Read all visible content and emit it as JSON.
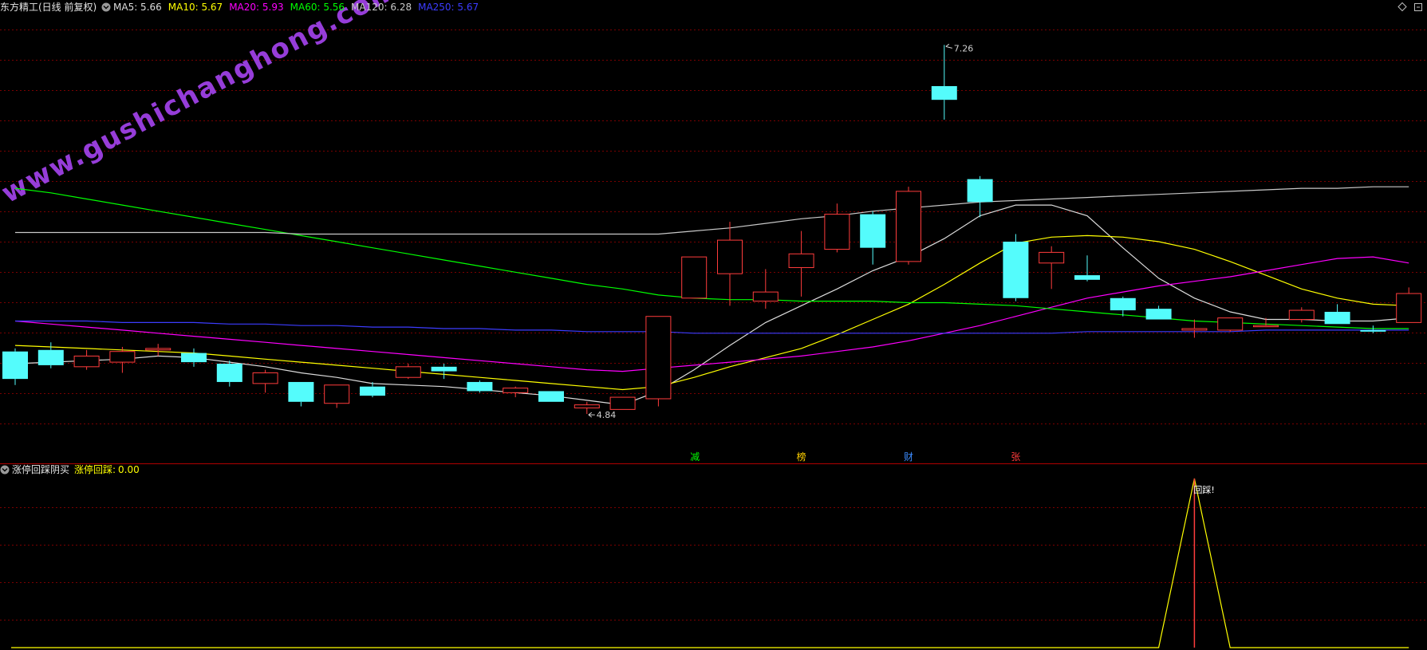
{
  "colors": {
    "bg": "#000000",
    "grid": "#7a0000",
    "up": "#ff3c3c",
    "down": "#54fcfc",
    "ma5": "#dcdcdc",
    "ma10": "#ffff00",
    "ma20": "#ff00ff",
    "ma60": "#00ff00",
    "ma120": "#c8c8c8",
    "ma250": "#3c3cff",
    "indicator": "#ffff00",
    "marker": "#ff3c3c",
    "watermark": "#b048ff"
  },
  "header": {
    "title": "东方精工(日线 前复权)",
    "ma": [
      {
        "label": "MA5:",
        "value": "5.66",
        "color": "#dcdcdc"
      },
      {
        "label": "MA10:",
        "value": "5.67",
        "color": "#ffff00"
      },
      {
        "label": "MA20:",
        "value": "5.93",
        "color": "#ff00ff"
      },
      {
        "label": "MA60:",
        "value": "5.56",
        "color": "#00ff00"
      },
      {
        "label": "MA120:",
        "value": "6.28",
        "color": "#c8c8c8"
      },
      {
        "label": "MA250:",
        "value": "5.67",
        "color": "#3c3cff"
      }
    ],
    "icons": [
      "collapse-icon",
      "diamond-icon",
      "restore-icon"
    ]
  },
  "watermark": "www.gushichanghong.com",
  "price_panel": {
    "high_label": "7.26",
    "low_label": "4.84",
    "event_markers": [
      {
        "text": "减",
        "color": "#00ff00"
      },
      {
        "text": "榜",
        "color": "#ffd000"
      },
      {
        "text": "财",
        "color": "#3c8cff"
      },
      {
        "text": "张",
        "color": "#ff3c3c"
      }
    ]
  },
  "indicator_panel": {
    "title": "涨停回踩阴买",
    "series_label": "涨停回踩:",
    "series_value": "0.00",
    "signal_label": "回踩!"
  },
  "chart_data": {
    "type": "candlestick",
    "title": "东方精工(日线 前复权)",
    "ylim": [
      4.6,
      7.45
    ],
    "candles": [
      {
        "o": 5.25,
        "c": 5.07,
        "h": 5.27,
        "l": 5.03
      },
      {
        "o": 5.26,
        "c": 5.16,
        "h": 5.31,
        "l": 5.14
      },
      {
        "o": 5.15,
        "c": 5.22,
        "h": 5.26,
        "l": 5.13
      },
      {
        "o": 5.18,
        "c": 5.25,
        "h": 5.28,
        "l": 5.11
      },
      {
        "o": 5.26,
        "c": 5.27,
        "h": 5.3,
        "l": 5.22
      },
      {
        "o": 5.24,
        "c": 5.18,
        "h": 5.27,
        "l": 5.15
      },
      {
        "o": 5.17,
        "c": 5.05,
        "h": 5.19,
        "l": 5.02
      },
      {
        "o": 5.04,
        "c": 5.11,
        "h": 5.13,
        "l": 4.98
      },
      {
        "o": 5.05,
        "c": 4.92,
        "h": 5.05,
        "l": 4.89
      },
      {
        "o": 4.91,
        "c": 5.03,
        "h": 5.03,
        "l": 4.88
      },
      {
        "o": 5.02,
        "c": 4.96,
        "h": 5.05,
        "l": 4.95
      },
      {
        "o": 5.08,
        "c": 5.15,
        "h": 5.17,
        "l": 5.07
      },
      {
        "o": 5.15,
        "c": 5.12,
        "h": 5.17,
        "l": 5.07
      },
      {
        "o": 5.05,
        "c": 4.99,
        "h": 5.06,
        "l": 4.98
      },
      {
        "o": 4.98,
        "c": 5.01,
        "h": 5.02,
        "l": 4.95
      },
      {
        "o": 4.99,
        "c": 4.92,
        "h": 4.99,
        "l": 4.92
      },
      {
        "o": 4.88,
        "c": 4.9,
        "h": 4.92,
        "l": 4.84
      },
      {
        "o": 4.87,
        "c": 4.95,
        "h": 4.95,
        "l": 4.87
      },
      {
        "o": 4.94,
        "c": 5.48,
        "h": 5.48,
        "l": 4.89
      },
      {
        "o": 5.6,
        "c": 5.87,
        "h": 5.87,
        "l": 5.6
      },
      {
        "o": 5.76,
        "c": 5.98,
        "h": 6.1,
        "l": 5.55
      },
      {
        "o": 5.58,
        "c": 5.64,
        "h": 5.79,
        "l": 5.53
      },
      {
        "o": 5.8,
        "c": 5.89,
        "h": 6.04,
        "l": 5.61
      },
      {
        "o": 5.92,
        "c": 6.15,
        "h": 6.22,
        "l": 5.9
      },
      {
        "o": 6.15,
        "c": 5.93,
        "h": 6.17,
        "l": 5.82
      },
      {
        "o": 5.84,
        "c": 6.3,
        "h": 6.33,
        "l": 5.82
      },
      {
        "o": 6.99,
        "c": 6.9,
        "h": 7.26,
        "l": 6.77
      },
      {
        "o": 6.38,
        "c": 6.23,
        "h": 6.4,
        "l": 6.13
      },
      {
        "o": 5.97,
        "c": 5.6,
        "h": 6.02,
        "l": 5.58
      },
      {
        "o": 5.83,
        "c": 5.9,
        "h": 5.94,
        "l": 5.66
      },
      {
        "o": 5.75,
        "c": 5.72,
        "h": 5.88,
        "l": 5.71
      },
      {
        "o": 5.6,
        "c": 5.52,
        "h": 5.61,
        "l": 5.48
      },
      {
        "o": 5.53,
        "c": 5.46,
        "h": 5.55,
        "l": 5.46
      },
      {
        "o": 5.39,
        "c": 5.4,
        "h": 5.46,
        "l": 5.34
      },
      {
        "o": 5.39,
        "c": 5.47,
        "h": 5.47,
        "l": 5.38
      },
      {
        "o": 5.42,
        "c": 5.42,
        "h": 5.47,
        "l": 5.41
      },
      {
        "o": 5.46,
        "c": 5.52,
        "h": 5.54,
        "l": 5.44
      },
      {
        "o": 5.51,
        "c": 5.43,
        "h": 5.56,
        "l": 5.43
      },
      {
        "o": 5.39,
        "c": 5.38,
        "h": 5.42,
        "l": 5.37
      },
      {
        "o": 5.44,
        "c": 5.63,
        "h": 5.67,
        "l": 5.44
      }
    ],
    "ma_series": [
      {
        "name": "MA5",
        "color": "#dcdcdc",
        "values": [
          5.17,
          5.18,
          5.19,
          5.2,
          5.22,
          5.21,
          5.18,
          5.15,
          5.11,
          5.08,
          5.04,
          5.03,
          5.02,
          5.0,
          4.98,
          4.96,
          4.93,
          4.9,
          4.99,
          5.13,
          5.29,
          5.44,
          5.55,
          5.66,
          5.78,
          5.87,
          5.99,
          6.14,
          6.21,
          6.21,
          6.14,
          5.93,
          5.73,
          5.6,
          5.51,
          5.46,
          5.46,
          5.45,
          5.45,
          5.47
        ]
      },
      {
        "name": "MA10",
        "color": "#ffff00",
        "values": [
          5.29,
          5.28,
          5.27,
          5.26,
          5.25,
          5.24,
          5.22,
          5.2,
          5.18,
          5.16,
          5.14,
          5.12,
          5.1,
          5.08,
          5.06,
          5.04,
          5.02,
          5.0,
          5.02,
          5.08,
          5.15,
          5.21,
          5.27,
          5.36,
          5.46,
          5.56,
          5.69,
          5.83,
          5.96,
          6.0,
          6.01,
          6.0,
          5.97,
          5.92,
          5.84,
          5.75,
          5.66,
          5.6,
          5.56,
          5.55
        ]
      },
      {
        "name": "MA20",
        "color": "#ff00ff",
        "values": [
          5.45,
          5.43,
          5.41,
          5.39,
          5.37,
          5.35,
          5.33,
          5.31,
          5.29,
          5.27,
          5.25,
          5.23,
          5.21,
          5.19,
          5.17,
          5.15,
          5.13,
          5.12,
          5.14,
          5.16,
          5.18,
          5.2,
          5.22,
          5.25,
          5.28,
          5.32,
          5.37,
          5.42,
          5.48,
          5.54,
          5.6,
          5.64,
          5.68,
          5.71,
          5.74,
          5.78,
          5.82,
          5.86,
          5.87,
          5.83
        ]
      },
      {
        "name": "MA60",
        "color": "#00ff00",
        "values": [
          6.32,
          6.29,
          6.25,
          6.21,
          6.17,
          6.13,
          6.09,
          6.05,
          6.01,
          5.97,
          5.93,
          5.89,
          5.85,
          5.81,
          5.77,
          5.73,
          5.69,
          5.66,
          5.62,
          5.6,
          5.59,
          5.59,
          5.58,
          5.58,
          5.58,
          5.57,
          5.57,
          5.56,
          5.55,
          5.53,
          5.51,
          5.49,
          5.47,
          5.45,
          5.44,
          5.43,
          5.42,
          5.41,
          5.4,
          5.4
        ]
      },
      {
        "name": "MA120",
        "color": "#c8c8c8",
        "values": [
          6.03,
          6.03,
          6.03,
          6.03,
          6.03,
          6.03,
          6.03,
          6.03,
          6.02,
          6.02,
          6.02,
          6.02,
          6.02,
          6.02,
          6.02,
          6.02,
          6.02,
          6.02,
          6.02,
          6.04,
          6.06,
          6.09,
          6.12,
          6.14,
          6.17,
          6.19,
          6.21,
          6.23,
          6.24,
          6.25,
          6.26,
          6.27,
          6.28,
          6.29,
          6.3,
          6.31,
          6.32,
          6.32,
          6.33,
          6.33
        ]
      },
      {
        "name": "MA250",
        "color": "#3c3cff",
        "values": [
          5.45,
          5.45,
          5.45,
          5.44,
          5.44,
          5.44,
          5.43,
          5.43,
          5.42,
          5.42,
          5.41,
          5.41,
          5.4,
          5.4,
          5.39,
          5.39,
          5.38,
          5.38,
          5.38,
          5.37,
          5.37,
          5.37,
          5.37,
          5.37,
          5.37,
          5.37,
          5.37,
          5.37,
          5.37,
          5.37,
          5.38,
          5.38,
          5.38,
          5.38,
          5.38,
          5.39,
          5.39,
          5.39,
          5.39,
          5.39
        ]
      }
    ],
    "indicator": {
      "name": "涨停回踩",
      "ylim": [
        0,
        1
      ],
      "values": [
        0,
        0,
        0,
        0,
        0,
        0,
        0,
        0,
        0,
        0,
        0,
        0,
        0,
        0,
        0,
        0,
        0,
        0,
        0,
        0,
        0,
        0,
        0,
        0,
        0,
        0,
        0,
        0,
        0,
        0,
        0,
        0,
        0,
        1,
        0,
        0,
        0,
        0,
        0,
        0
      ],
      "signal_index": 33
    }
  }
}
